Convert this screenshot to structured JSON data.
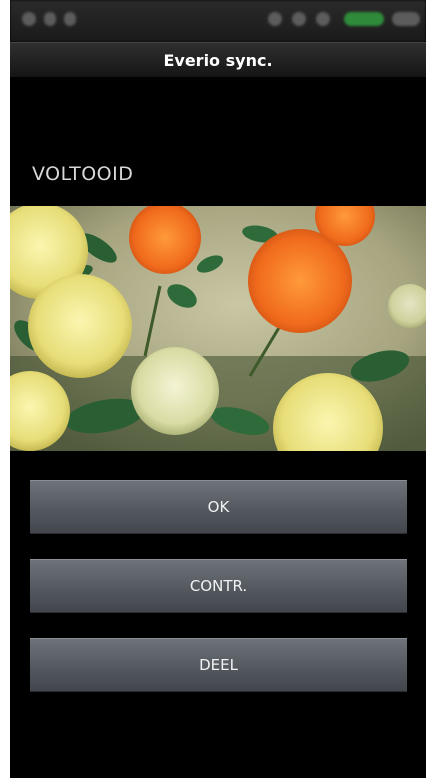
{
  "app": {
    "title": "Everio sync."
  },
  "status": {
    "label": "VOLTOOID"
  },
  "buttons": {
    "ok_label": "OK",
    "contr_label": "CONTR.",
    "share_label": "DEEL"
  },
  "colors": {
    "background": "#000000",
    "button_top": "#6e737a",
    "button_bottom": "#42464c",
    "text": "#f2f2f2"
  }
}
